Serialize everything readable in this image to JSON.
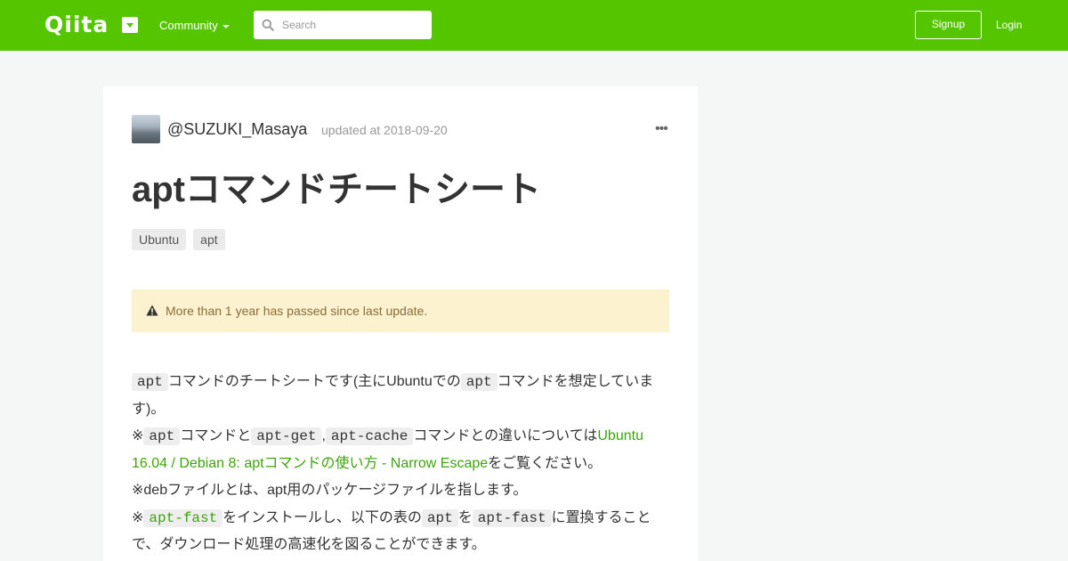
{
  "header": {
    "logo": "Qiita",
    "community_label": "Community",
    "search_placeholder": "Search",
    "signup_label": "Signup",
    "login_label": "Login",
    "colors": {
      "brand": "#55c500"
    },
    "icons": {
      "logo_menu": "chevron-down-icon",
      "community_caret": "caret-down-icon",
      "search": "search-icon"
    }
  },
  "article": {
    "author": "@SUZUKI_Masaya",
    "updated": "updated at 2018-09-20",
    "more_icon": "more-icon",
    "title": "aptコマンドチートシート",
    "tags": [
      "Ubuntu",
      "apt"
    ],
    "notice": {
      "icon": "warning-icon",
      "text": "More than 1 year has passed since last update."
    },
    "body": {
      "p1": {
        "code1": "apt",
        "t1": "コマンドのチートシートです(主にUbuntuでの",
        "code2": "apt",
        "t2": "コマンドを想定しています)。"
      },
      "p2": {
        "t0": "※",
        "code1": "apt",
        "t1": "コマンドと",
        "code2": "apt-get",
        "t2": ",",
        "code3": "apt-cache",
        "t3": "コマンドとの違いについては",
        "link": "Ubuntu 16.04 / Debian 8: aptコマンドの使い方 - Narrow Escape",
        "t4": "をご覧ください。"
      },
      "p3": {
        "t0": "※debファイルとは、apt用のパッケージファイルを指します。"
      },
      "p4": {
        "t0": "※",
        "link_code": "apt-fast",
        "t1": "をインストールし、以下の表の",
        "code1": "apt",
        "t2": "を",
        "code2": "apt-fast",
        "t3": "に置換することで、ダウンロード処理の高速化を図ることができます。"
      }
    }
  }
}
